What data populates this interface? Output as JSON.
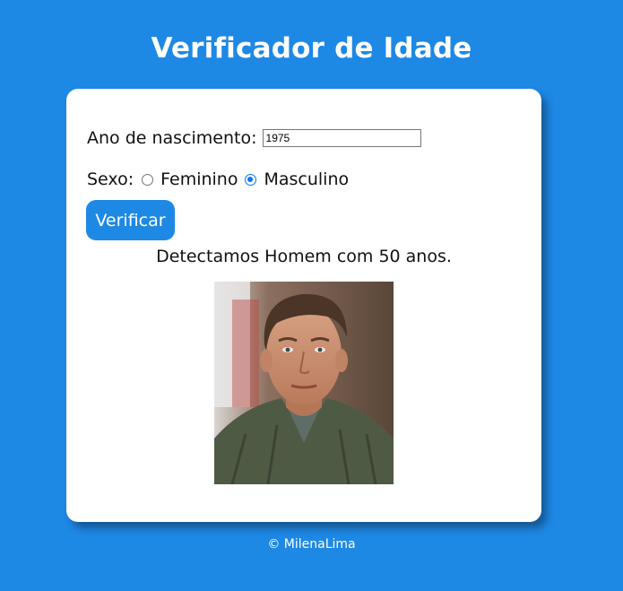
{
  "page": {
    "title": "Verificador de Idade",
    "footer": "© MilenaLima"
  },
  "form": {
    "birth_year_label": "Ano de nascimento:",
    "birth_year_value": "1975",
    "sex_label": "Sexo:",
    "sex_options": [
      {
        "label": "Feminino",
        "selected": false
      },
      {
        "label": "Masculino",
        "selected": true
      }
    ],
    "verify_button": "Verificar"
  },
  "result": {
    "text": "Detectamos Homem com 50 anos.",
    "photo_icon": "man-portrait-photo"
  },
  "colors": {
    "background": "#1e88e5",
    "button": "#1e88e5",
    "card": "#ffffff",
    "radio_accent": "#0075ff"
  }
}
